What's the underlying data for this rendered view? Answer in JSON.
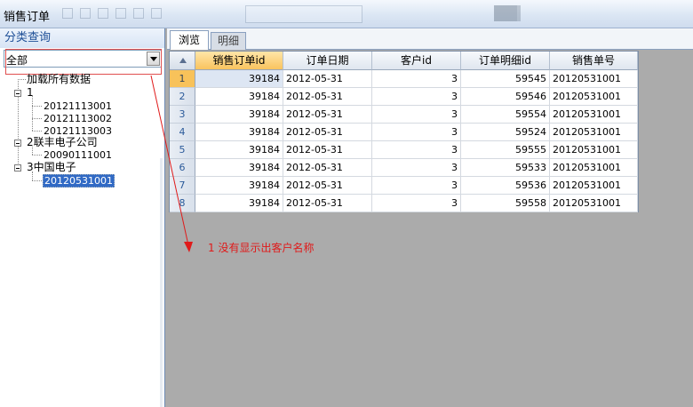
{
  "window": {
    "title": "销售订单"
  },
  "left_panel": {
    "title": "分类查询",
    "combo_value": "全部",
    "tree": [
      {
        "label": "加载所有数据",
        "level": 0
      },
      {
        "label": "1",
        "level": 0
      },
      {
        "label": "20121113001",
        "level": 1
      },
      {
        "label": "20121113002",
        "level": 1
      },
      {
        "label": "20121113003",
        "level": 1
      },
      {
        "label": "2联丰电子公司",
        "level": 0
      },
      {
        "label": "20090111001",
        "level": 1
      },
      {
        "label": "3中国电子",
        "level": 0
      },
      {
        "label": "20120531001",
        "level": 1,
        "selected": true
      }
    ]
  },
  "tabs": [
    {
      "label": "浏览",
      "active": true
    },
    {
      "label": "明细",
      "active": false
    }
  ],
  "grid": {
    "columns": [
      "销售订单id",
      "订单日期",
      "客户id",
      "订单明细id",
      "销售单号"
    ],
    "sorted_column": 0,
    "rows": [
      {
        "num": "1",
        "cells": [
          "39184",
          "2012-05-31",
          "3",
          "59545",
          "20120531001"
        ]
      },
      {
        "num": "2",
        "cells": [
          "39184",
          "2012-05-31",
          "3",
          "59546",
          "20120531001"
        ]
      },
      {
        "num": "3",
        "cells": [
          "39184",
          "2012-05-31",
          "3",
          "59554",
          "20120531001"
        ]
      },
      {
        "num": "4",
        "cells": [
          "39184",
          "2012-05-31",
          "3",
          "59524",
          "20120531001"
        ]
      },
      {
        "num": "5",
        "cells": [
          "39184",
          "2012-05-31",
          "3",
          "59555",
          "20120531001"
        ]
      },
      {
        "num": "6",
        "cells": [
          "39184",
          "2012-05-31",
          "3",
          "59533",
          "20120531001"
        ]
      },
      {
        "num": "7",
        "cells": [
          "39184",
          "2012-05-31",
          "3",
          "59536",
          "20120531001"
        ]
      },
      {
        "num": "8",
        "cells": [
          "39184",
          "2012-05-31",
          "3",
          "59558",
          "20120531001"
        ]
      }
    ]
  },
  "annotation": {
    "text": "1   没有显示出客户名称",
    "color": "#e01a1a"
  },
  "colors": {
    "accent": "#316ac5",
    "sorted_header": "#f9c35e",
    "background": "#ababab"
  }
}
